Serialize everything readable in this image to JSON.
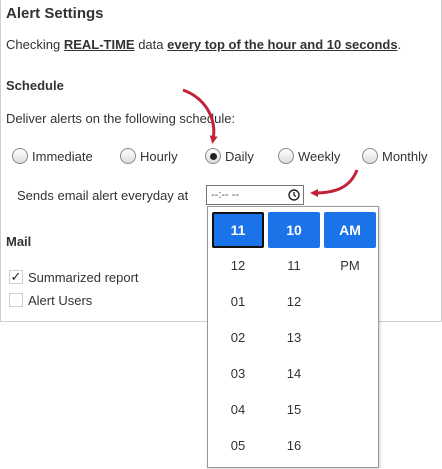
{
  "panel": {
    "title": "Alert Settings",
    "desc": {
      "prefix": "Checking ",
      "realtime": "REAL-TIME",
      "middle": " data ",
      "schedule_text": "every top of the hour and 10 seconds",
      "suffix": "."
    }
  },
  "schedule": {
    "heading": "Schedule",
    "instruction": "Deliver alerts on the following schedule:",
    "options": [
      {
        "label": "Immediate",
        "checked": false
      },
      {
        "label": "Hourly",
        "checked": false
      },
      {
        "label": "Daily",
        "checked": true
      },
      {
        "label": "Weekly",
        "checked": false
      },
      {
        "label": "Monthly",
        "checked": false
      }
    ],
    "send_label": "Sends email alert everyday at",
    "time_placeholder": "--:-- --"
  },
  "mail": {
    "heading": "Mail",
    "summarized": {
      "label": "Summarized report",
      "checked": true
    },
    "alert_users": {
      "label": "Alert Users",
      "checked": false
    }
  },
  "time_picker": {
    "hours": [
      "11",
      "12",
      "01",
      "02",
      "03",
      "04",
      "05"
    ],
    "minutes": [
      "10",
      "11",
      "12",
      "13",
      "14",
      "15",
      "16"
    ],
    "periods": [
      "AM",
      "PM"
    ]
  },
  "colors": {
    "accent": "#1a73e8",
    "arrow": "#c0223a"
  },
  "icons": {
    "clock": "clock-icon",
    "check": "checkmark-icon"
  }
}
